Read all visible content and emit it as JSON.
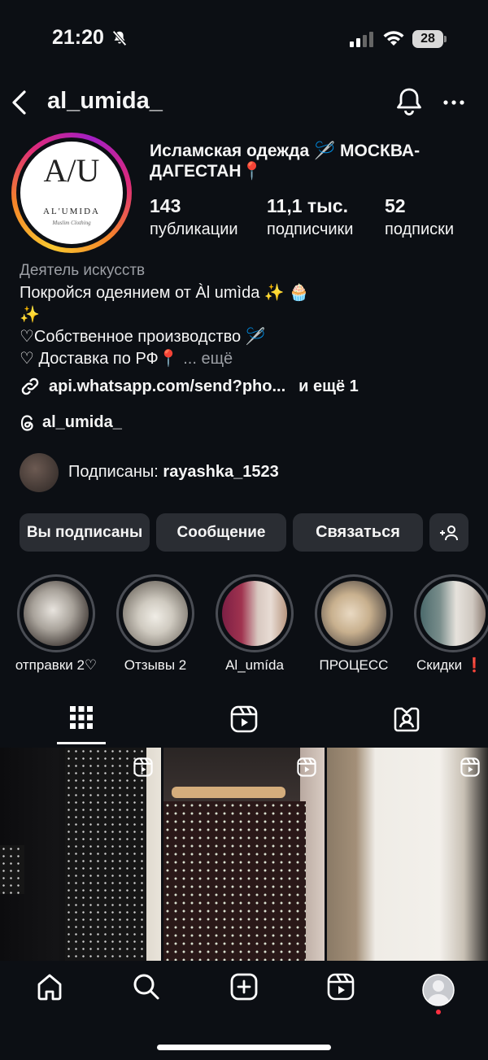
{
  "status_bar": {
    "time": "21:20",
    "battery": "28"
  },
  "header": {
    "username": "al_umida_"
  },
  "profile": {
    "logo": {
      "monogram": "A/U",
      "name": "AL'UMIDA",
      "subtitle": "Muslim Clothing"
    },
    "display_name": "Исламская одежда 🪡 МОСКВА-ДАГЕСТАН📍",
    "stats": [
      {
        "value": "143",
        "label": "публикации"
      },
      {
        "value": "11,1 тыс.",
        "label": "подписчики"
      },
      {
        "value": "52",
        "label": "подписки"
      }
    ],
    "category": "Деятель искусств",
    "bio": [
      "Покройся одеянием от Àl umìda ✨ 🧁",
      "✨",
      "♡Собственное производство 🪡",
      "♡ Доставка по РФ📍"
    ],
    "bio_more": "... ещё",
    "link": "api.whatsapp.com/send?pho...",
    "link_more": "и ещё 1",
    "threads": "al_umida_",
    "followed_by_prefix": "Подписаны:",
    "followed_by_user": "rayashka_1523"
  },
  "buttons": {
    "following": "Вы подписаны",
    "message": "Сообщение",
    "contact": "Связаться"
  },
  "highlights": [
    {
      "label": "отправки 2♡"
    },
    {
      "label": "Отзывы 2"
    },
    {
      "label": "Al_umída"
    },
    {
      "label": "ПРОЦЕСС"
    },
    {
      "label": "Скидки ❗"
    }
  ],
  "colors": {
    "background": "#0c0f14",
    "button": "#2a2d33",
    "muted_text": "#9b9ea4",
    "notification_dot": "#ff3040"
  }
}
